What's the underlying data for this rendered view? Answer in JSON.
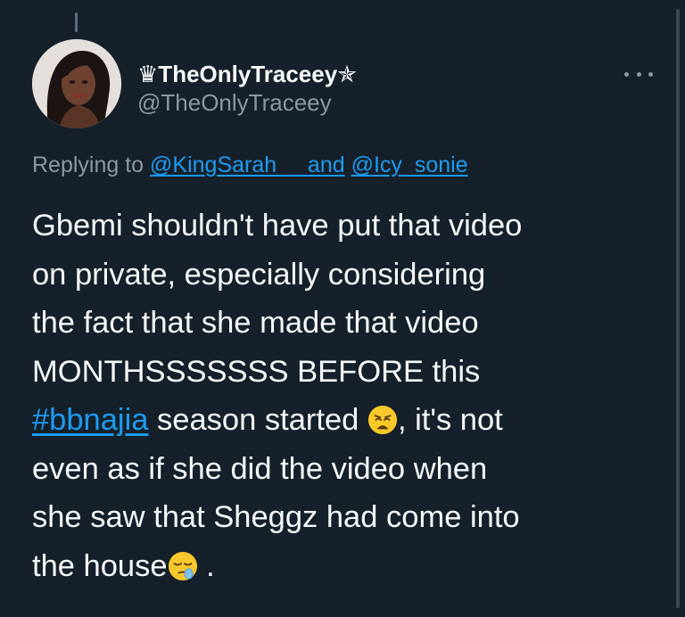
{
  "tweet": {
    "display_name": "♛TheOnlyTraceey✯",
    "handle": "@TheOnlyTraceey",
    "more_icon": "more-horizontal-icon",
    "replying_to_prefix": "Replying to",
    "mention_1": "@KingSarah__",
    "replying_joiner": "and",
    "mention_2": "@Icy_sonie",
    "body": {
      "line_1": "Gbemi shouldn't have put that video",
      "line_2": "on private, especially considering",
      "line_3": "the fact that she made that video",
      "line_4": "MONTHSSSSSSS BEFORE this",
      "hashtag": "#bbnajia",
      "line_5_rest": " season started ",
      "line_5_end": ", it's not",
      "line_6": "even as if she did the video when",
      "line_7": "she saw that Sheggz had come into",
      "line_8": "the house",
      "line_8_end": " .",
      "emoji_1": "weary-face-emoji",
      "emoji_2": "sleepy-face-emoji"
    }
  },
  "colors": {
    "background": "#15202b",
    "text": "#f7f9f9",
    "secondary": "#8b98a5",
    "link": "#1d9bf0"
  }
}
